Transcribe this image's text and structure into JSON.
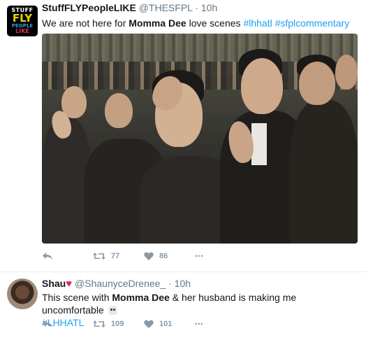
{
  "colors": {
    "link": "#1da1f2",
    "muted": "#657786",
    "action": "#8899a6",
    "heart": "#e0245e"
  },
  "tweets": [
    {
      "name": "StuffFLYPeopleLIKE",
      "handle": "@THESFPL",
      "dot": "·",
      "time": "10h",
      "avatar_text": {
        "line1": "STUFF",
        "line2": "FLY",
        "line3": "PEOPLE",
        "line4": "LIKE"
      },
      "text": {
        "prefix": "We are not here for ",
        "bold": "Momma Dee",
        "middle": " love scenes ",
        "tag1": "#lhhatl",
        "space": " ",
        "tag2": "#sfplcommentary"
      },
      "media_icon": "photo-crowd-crying",
      "actions": {
        "reply_icon": "reply-icon",
        "retweets": "77",
        "likes": "86",
        "more": "•••"
      }
    },
    {
      "name": "Shau",
      "name_emoji": "♥",
      "handle": "@ShaunyceDrenee_",
      "dot": "·",
      "time": "10h",
      "text": {
        "prefix": "This scene with ",
        "bold": "Momma Dee",
        "middle": " & her husband is making me uncomfortable ",
        "tag1": "#LHHATL"
      },
      "actions": {
        "reply_icon": "reply-icon",
        "retweets": "109",
        "likes": "101",
        "more": "•••"
      }
    }
  ]
}
